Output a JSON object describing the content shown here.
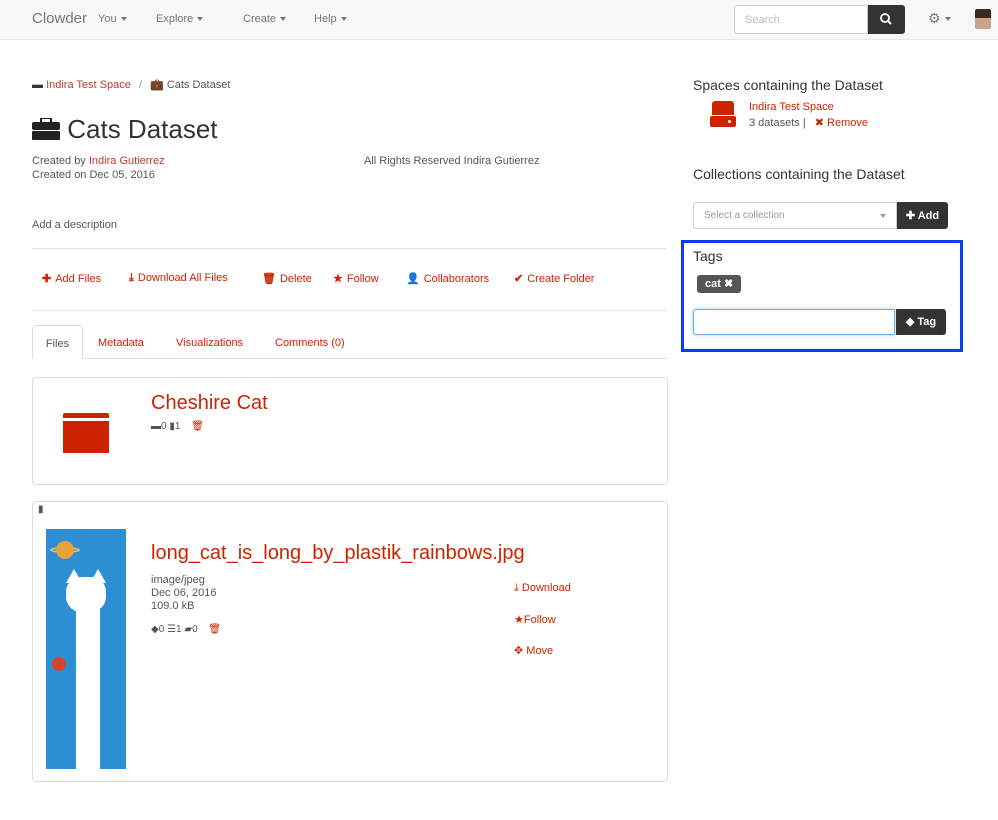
{
  "navbar": {
    "brand": "Clowder",
    "menus": [
      "You",
      "Explore",
      "Create",
      "Help"
    ],
    "search_placeholder": "Search"
  },
  "breadcrumb": {
    "space": "Indira Test Space",
    "separator": "/",
    "current": "Cats Dataset"
  },
  "dataset": {
    "title": "Cats Dataset",
    "created_by_prefix": "Created by",
    "creator": "Indira Gutierrez",
    "created_on": "Created on Dec 05, 2016",
    "rights": "All Rights Reserved Indira Gutierrez",
    "add_description": "Add a description"
  },
  "actions": {
    "add_files": "Add Files",
    "download_all": "Download All Files",
    "delete": "Delete",
    "follow": "Follow",
    "collaborators": "Collaborators",
    "create_folder": "Create Folder"
  },
  "tabs": [
    "Files",
    "Metadata",
    "Visualizations",
    "Comments (0)"
  ],
  "folder_item": {
    "name": "Cheshire Cat",
    "folders": "0",
    "files": "1"
  },
  "file_item": {
    "name": "long_cat_is_long_by_plastik_rainbows.jpg",
    "type": "image/jpeg",
    "date": "Dec 06, 2016",
    "size": "109.0 kB",
    "tags_count": "0",
    "metadata_count": "1",
    "comments_count": "0",
    "download": "Download",
    "follow": "Follow",
    "move": "Move"
  },
  "spaces_section": {
    "heading": "Spaces containing the Dataset",
    "space_name": "Indira Test Space",
    "datasets": "3 datasets",
    "divider": "|",
    "remove": "Remove"
  },
  "collections_section": {
    "heading": "Collections containing the Dataset",
    "select_placeholder": "Select a collection",
    "add": "Add"
  },
  "tags_section": {
    "heading": "Tags",
    "tags": [
      "cat"
    ],
    "button": "Tag"
  },
  "colors": {
    "accent": "#cc2200",
    "highlight_box": "#0a3cf0",
    "dark_button": "#333333"
  }
}
